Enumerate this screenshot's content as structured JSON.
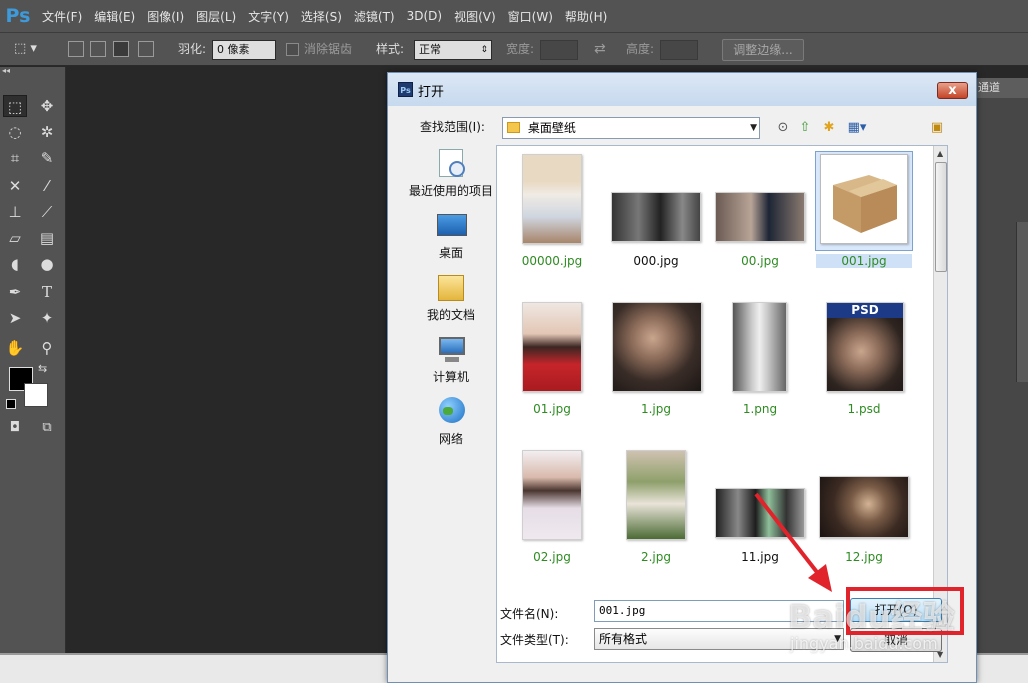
{
  "app": {
    "logo": "Ps"
  },
  "menu": [
    "文件(F)",
    "编辑(E)",
    "图像(I)",
    "图层(L)",
    "文字(Y)",
    "选择(S)",
    "滤镜(T)",
    "3D(D)",
    "视图(V)",
    "窗口(W)",
    "帮助(H)"
  ],
  "options": {
    "feather_label": "羽化:",
    "feather_value": "0 像素",
    "antialias_label": "消除锯齿",
    "style_label": "样式:",
    "style_value": "正常",
    "width_label": "宽度:",
    "height_label": "高度:",
    "refine_edge_button": "调整边缘..."
  },
  "right_panel": {
    "tab_label": "通道"
  },
  "dialog": {
    "title": "打开",
    "close_glyph": "x",
    "look_in_label": "查找范围(I):",
    "look_in_value": "桌面壁纸",
    "places": [
      {
        "label": "最近使用的项目",
        "icon": "recent-items-icon"
      },
      {
        "label": "桌面",
        "icon": "desktop-icon"
      },
      {
        "label": "我的文档",
        "icon": "my-documents-icon"
      },
      {
        "label": "计算机",
        "icon": "computer-icon"
      },
      {
        "label": "网络",
        "icon": "network-icon"
      }
    ],
    "files": [
      {
        "name": "00000.jpg",
        "color": "#2e8b22",
        "selected": false
      },
      {
        "name": "000.jpg",
        "color": "#111111",
        "selected": false
      },
      {
        "name": "00.jpg",
        "color": "#2e8b22",
        "selected": false
      },
      {
        "name": "001.jpg",
        "color": "#2e8b22",
        "selected": true
      },
      {
        "name": "01.jpg",
        "color": "#2e8b22",
        "selected": false
      },
      {
        "name": "1.jpg",
        "color": "#2e8b22",
        "selected": false
      },
      {
        "name": "1.png",
        "color": "#2e8b22",
        "selected": false
      },
      {
        "name": "1.psd",
        "color": "#2e8b22",
        "selected": false
      },
      {
        "name": "02.jpg",
        "color": "#2e8b22",
        "selected": false
      },
      {
        "name": "2.jpg",
        "color": "#2e8b22",
        "selected": false
      },
      {
        "name": "11.jpg",
        "color": "#111111",
        "selected": false
      },
      {
        "name": "12.jpg",
        "color": "#2e8b22",
        "selected": false
      }
    ],
    "psd_thumb_text": "PSD",
    "filename_label": "文件名(N):",
    "filename_value": "001.jpg",
    "filetype_label": "文件类型(T):",
    "filetype_value": "所有格式",
    "open_button": "打开(O)",
    "cancel_button": "取消"
  },
  "watermark": {
    "main": "Baidu经验",
    "sub": "jingyan.baidu.com"
  },
  "colors": {
    "accent_red": "#e1242c",
    "ps_blue": "#3d9bdc",
    "file_green": "#2e8b22"
  }
}
